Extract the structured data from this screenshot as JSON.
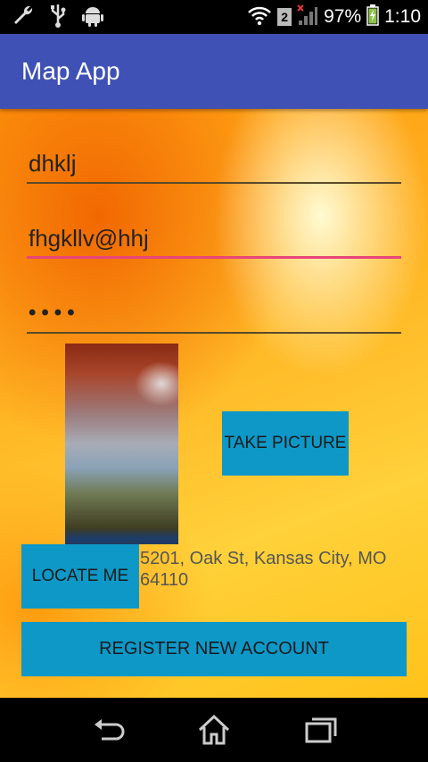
{
  "status_bar": {
    "sim_label": "2",
    "battery": "97%",
    "time": "1:10",
    "icons": [
      "wrench-icon",
      "usb-icon",
      "android-icon",
      "wifi-icon",
      "sim-icon",
      "signal-icon",
      "battery-icon"
    ]
  },
  "app_bar": {
    "title": "Map App"
  },
  "form": {
    "name_value": "dhklj",
    "email_value": "fhgkllv@hhj",
    "password_value": "••••"
  },
  "actions": {
    "take_picture_label": "TAKE PICTURE",
    "locate_me_label": "LOCATE ME",
    "register_label": "REGISTER NEW ACCOUNT"
  },
  "location": {
    "address": "5201, Oak St, Kansas City, MO 64110"
  },
  "nav_bar": {
    "icons": [
      "back-icon",
      "home-icon",
      "recent-apps-icon"
    ]
  },
  "colors": {
    "app_bar": "#3f51b5",
    "button": "#0d98c8",
    "focus_underline": "#e8457a"
  }
}
